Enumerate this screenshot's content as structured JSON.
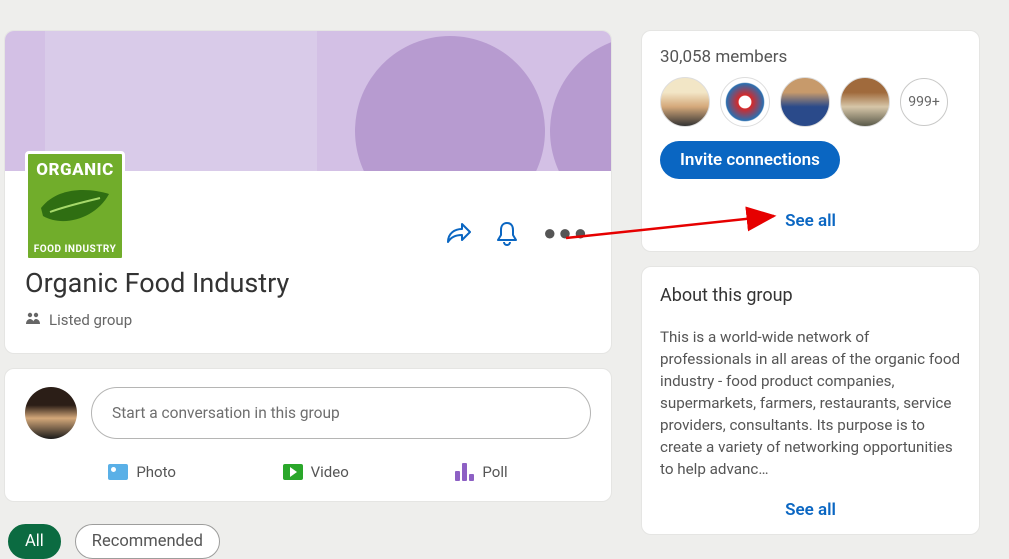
{
  "group": {
    "logo_top": "ORGANIC",
    "logo_bottom": "FOOD INDUSTRY",
    "title": "Organic Food Industry",
    "listed_label": "Listed group"
  },
  "post": {
    "placeholder": "Start a conversation in this group",
    "actions": {
      "photo": "Photo",
      "video": "Video",
      "poll": "Poll"
    }
  },
  "filters": {
    "all": "All",
    "recommended": "Recommended"
  },
  "members": {
    "count_label": "30,058 members",
    "overflow": "999+",
    "invite_label": "Invite connections",
    "see_all": "See all"
  },
  "about": {
    "heading": "About this group",
    "body": "This is a world-wide network of professionals in all areas of the organic food industry - food product companies, supermarkets, farmers, restaurants, service providers, consultants. Its purpose is to create a variety of networking opportunities to help advanc…",
    "see_all": "See all"
  }
}
